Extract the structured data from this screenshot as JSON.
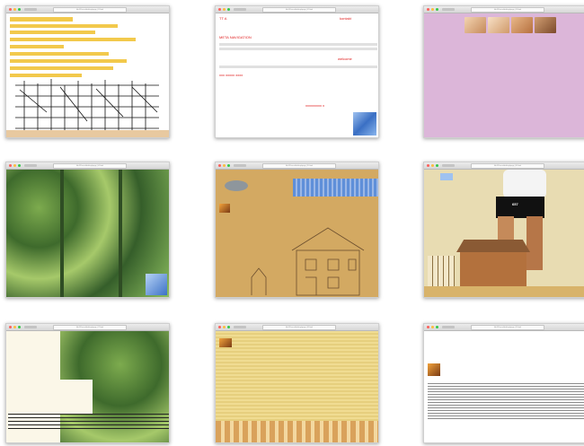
{
  "windows": [
    {
      "id": "w1",
      "url": "file:///Users/desktop/page_01.html"
    },
    {
      "id": "w2",
      "url": "file:///Users/desktop/page_02.html"
    },
    {
      "id": "w3",
      "url": "file:///Users/desktop/page_03.html"
    },
    {
      "id": "w4",
      "url": "file:///Users/desktop/page_04.html"
    },
    {
      "id": "w5",
      "url": "file:///Users/desktop/page_05.html"
    },
    {
      "id": "w6",
      "url": "file:///Users/desktop/page_06.html"
    },
    {
      "id": "w7",
      "url": "file:///Users/desktop/page_07.html"
    },
    {
      "id": "w8",
      "url": "file:///Users/desktop/page_08.html"
    },
    {
      "id": "w9",
      "url": "file:///Users/desktop/page_09.html"
    }
  ],
  "w2": {
    "heading": "TT A",
    "red_label_1": "META NAVIGATION",
    "red_label_2": "welcome",
    "red_label_3": "kontakt",
    "bottom_red": "xxxxxxxxx x",
    "link_line": "xxx xxxxx xxxx"
  },
  "w6": {
    "shorts_number": "657"
  },
  "colors": {
    "yellow_highlight": "#f2c94c",
    "pink_bg": "#dcb6d9",
    "sand_bg": "#d3a962",
    "blue_tile": "#5f8fd9",
    "red_text": "#e02020"
  }
}
